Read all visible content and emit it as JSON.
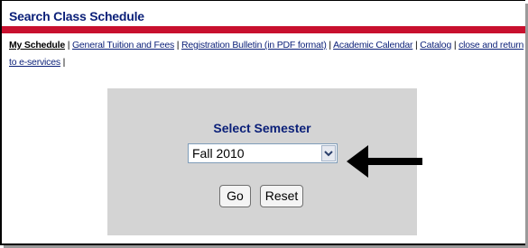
{
  "page": {
    "title": "Search Class Schedule"
  },
  "nav": {
    "items": [
      {
        "label": "My Schedule",
        "bold": true
      },
      {
        "label": "General Tuition and Fees"
      },
      {
        "label": "Registration Bulletin (in PDF format)"
      },
      {
        "label": "Academic Calendar"
      },
      {
        "label": "Catalog"
      },
      {
        "label": "close and return to e-services"
      }
    ],
    "separator": "|"
  },
  "form": {
    "label": "Select Semester",
    "selected": "Fall 2010",
    "go_label": "Go",
    "reset_label": "Reset"
  },
  "colors": {
    "title": "#0a1f78",
    "red_bar": "#c8102e",
    "panel": "#d4d4d4"
  },
  "icons": {
    "dropdown": "chevron-down-icon",
    "pointer": "arrow-left-icon"
  }
}
